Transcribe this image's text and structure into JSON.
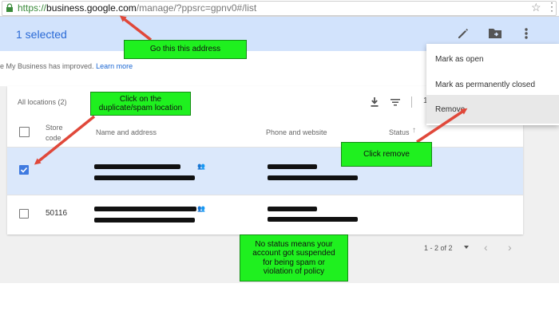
{
  "browser": {
    "url_scheme": "https://",
    "url_host": "business.google.com",
    "url_path": "/manage/?ppsrc=gpnv0#/list"
  },
  "header": {
    "selected_count": "1 selected"
  },
  "notice": {
    "text": "e My Business has improved.",
    "learn_more": "Learn more"
  },
  "toolbar": {
    "all_locations": "All locations  (2)",
    "partial": "1"
  },
  "table": {
    "headers": {
      "store_code_line1": "Store",
      "store_code_line2": "code",
      "name_address": "Name and address",
      "phone_website": "Phone and website",
      "status": "Status",
      "sort_arrow": "↑"
    },
    "rows": [
      {
        "store_code": "",
        "selected": true
      },
      {
        "store_code": "50116",
        "selected": false
      }
    ]
  },
  "pagination": {
    "range": "1 - 2 of 2",
    "prev": "‹",
    "next": "›"
  },
  "menu": {
    "items": [
      "Mark as open",
      "Mark as permanently closed",
      "Remove"
    ]
  },
  "annotations": {
    "address": "Go this this address",
    "click_location_line1": "Click on the",
    "click_location_line2": "duplicate/spam location",
    "click_remove": "Click remove",
    "no_status_line1": "No status means your",
    "no_status_line2": "account got suspended",
    "no_status_line3": "for being spam or",
    "no_status_line4": "violation of policy"
  },
  "colors": {
    "accent": "#2a6ad6",
    "selection": "#d2e3fc",
    "callout": "#1ff01f",
    "arrow": "#e0483a"
  },
  "icons": [
    "lock-icon",
    "star-icon",
    "edit-icon",
    "folder-move-icon",
    "more-vert-icon",
    "download-icon",
    "filter-icon",
    "people-icon",
    "dropdown-arrow-icon",
    "chevron-left-icon",
    "chevron-right-icon"
  ]
}
